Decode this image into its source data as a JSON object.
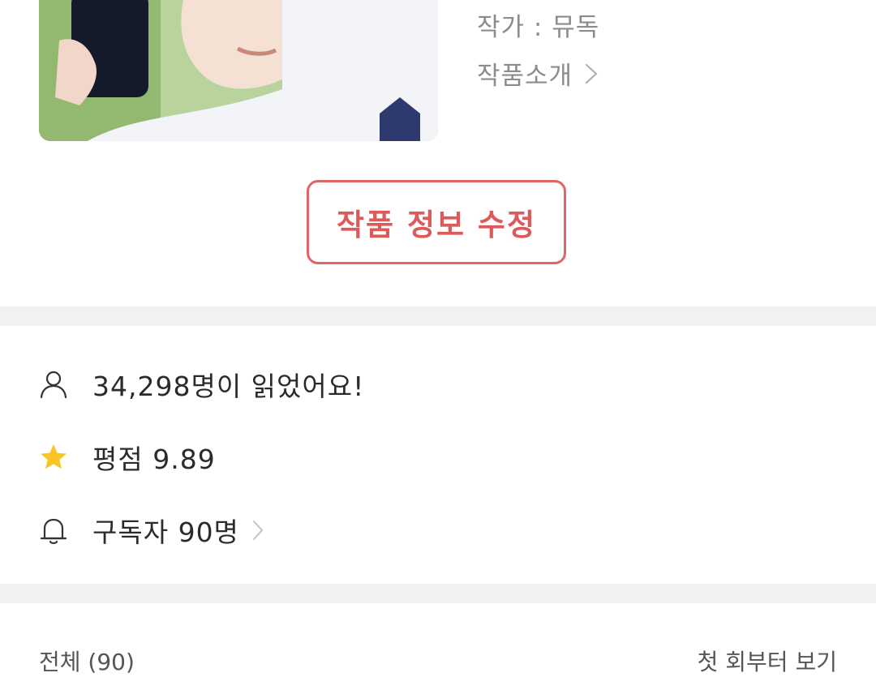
{
  "work": {
    "author_line": "작가 : 뮤독",
    "intro_label": "작품소개"
  },
  "edit_button": {
    "label": "작품 정보 수정"
  },
  "stats": {
    "readers": "34,298명이 읽었어요!",
    "rating": "평점 9.89",
    "subscribers": "구독자 90명"
  },
  "icons": {
    "readers": "person-icon",
    "rating": "star-icon",
    "subscribers": "bell-icon"
  },
  "colors": {
    "accent": "#e06565",
    "star": "#f7c625",
    "divider": "#f0f1f3"
  },
  "bottom": {
    "left": "전체 (90)",
    "right": "첫 회부터 보기"
  }
}
